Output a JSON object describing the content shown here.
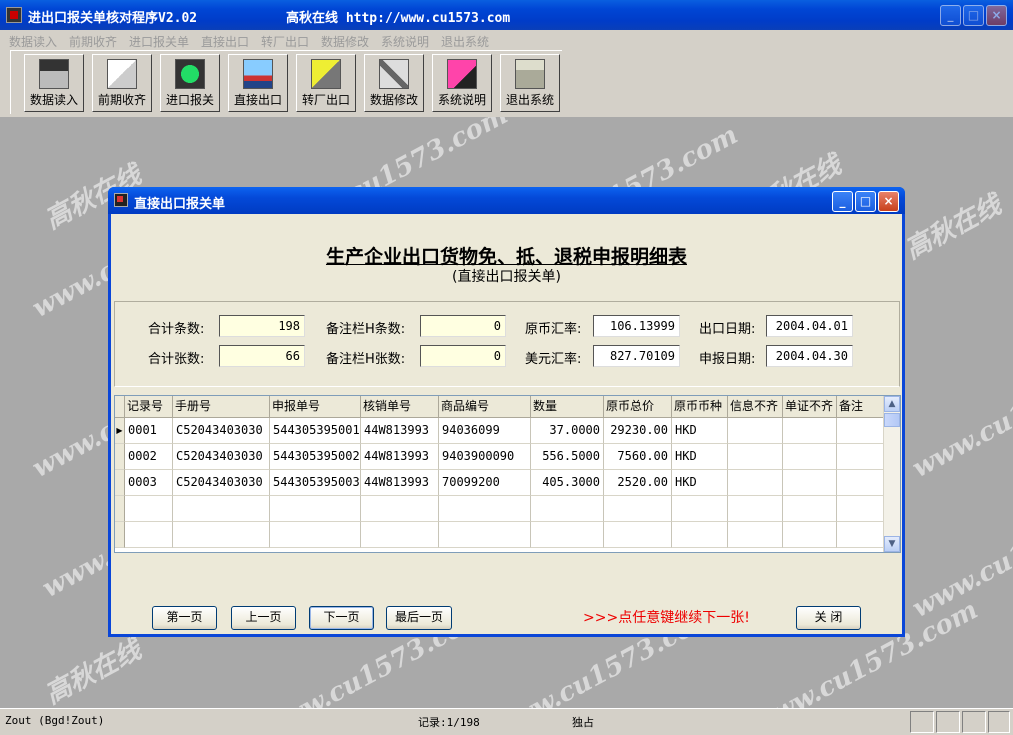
{
  "app": {
    "title": "进出口报关单核对程序V2.02",
    "site": "高秋在线 http://www.cu1573.com",
    "window_controls": [
      "_",
      "□",
      "×"
    ]
  },
  "menu": [
    "数据读入",
    "前期收齐",
    "进口报关单",
    "直接出口",
    "转厂出口",
    "数据修改",
    "系统说明",
    "退出系统"
  ],
  "toolbar": [
    {
      "label": "数据读入",
      "icon": "floppy-disk-icon"
    },
    {
      "label": "前期收齐",
      "icon": "documents-stack-icon"
    },
    {
      "label": "进口报关",
      "icon": "computer-monitor-icon"
    },
    {
      "label": "直接出口",
      "icon": "cargo-ship-icon"
    },
    {
      "label": "转厂出口",
      "icon": "delivery-truck-icon"
    },
    {
      "label": "数据修改",
      "icon": "pencil-icon"
    },
    {
      "label": "系统说明",
      "icon": "red-book-icon"
    },
    {
      "label": "退出系统",
      "icon": "folder-icon"
    }
  ],
  "watermark": {
    "site": "www.cu1573.com",
    "brand": "高秋在线"
  },
  "dialog": {
    "title": "直接出口报关单",
    "heading": "生产企业出口货物免、抵、退税申报明细表",
    "subheading": "(直接出口报关单)",
    "summary": {
      "total_records_label": "合计条数:",
      "total_records": "198",
      "total_sheets_label": "合计张数:",
      "total_sheets": "66",
      "remark_h_records_label": "备注栏H条数:",
      "remark_h_records": "0",
      "remark_h_sheets_label": "备注栏H张数:",
      "remark_h_sheets": "0",
      "orig_rate_label": "原币汇率:",
      "orig_rate": "106.13999",
      "usd_rate_label": "美元汇率:",
      "usd_rate": "827.70109",
      "export_date_label": "出口日期:",
      "export_date": "2004.04.01",
      "declare_date_label": "申报日期:",
      "declare_date": "2004.04.30"
    },
    "table": {
      "columns": [
        "记录号",
        "手册号",
        "申报单号",
        "核销单号",
        "商品编号",
        "数量",
        "原币总价",
        "原币币种",
        "信息不齐",
        "单证不齐",
        "备注"
      ],
      "rows": [
        [
          "0001",
          "C52043403030",
          "544305395001",
          "44W813993",
          "94036099",
          "37.0000",
          "29230.00",
          "HKD",
          "",
          "",
          ""
        ],
        [
          "0002",
          "C52043403030",
          "544305395002",
          "44W813993",
          "9403900090",
          "556.5000",
          "7560.00",
          "HKD",
          "",
          "",
          ""
        ],
        [
          "0003",
          "C52043403030",
          "544305395003",
          "44W813993",
          "70099200",
          "405.3000",
          "2520.00",
          "HKD",
          "",
          "",
          ""
        ]
      ]
    },
    "buttons": {
      "first": "第一页",
      "prev": "上一页",
      "next": "下一页",
      "last": "最后一页",
      "close": "关 闭"
    },
    "hint": ">>>点任意键继续下一张!"
  },
  "status": {
    "left": "Zout (Bgd!Zout)",
    "record": "记录:1/198",
    "mode": "独占"
  }
}
